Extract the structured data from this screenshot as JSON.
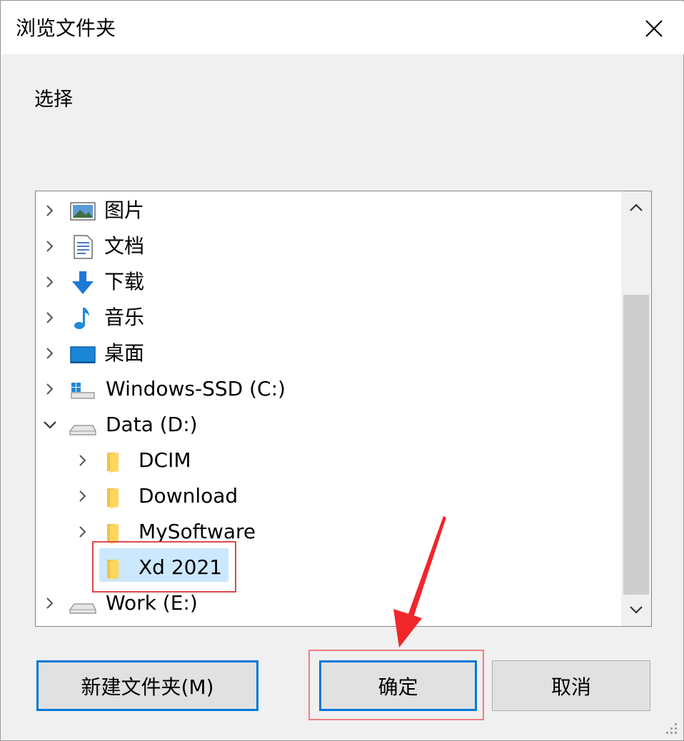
{
  "dialog": {
    "title": "浏览文件夹",
    "prompt": "选择"
  },
  "tree": {
    "items": [
      {
        "label": "图片",
        "icon": "pictures-icon",
        "expanded": false
      },
      {
        "label": "文档",
        "icon": "documents-icon",
        "expanded": false
      },
      {
        "label": "下载",
        "icon": "downloads-icon",
        "expanded": false
      },
      {
        "label": "音乐",
        "icon": "music-icon",
        "expanded": false
      },
      {
        "label": "桌面",
        "icon": "desktop-icon",
        "expanded": false
      },
      {
        "label": "Windows-SSD (C:)",
        "icon": "windows-drive-icon",
        "expanded": false
      },
      {
        "label": "Data (D:)",
        "icon": "drive-icon",
        "expanded": true
      },
      {
        "label": "DCIM",
        "icon": "folder-icon",
        "expanded": false
      },
      {
        "label": "Download",
        "icon": "folder-icon",
        "expanded": false
      },
      {
        "label": "MySoftware",
        "icon": "folder-icon",
        "expanded": false
      },
      {
        "label": "Xd 2021",
        "icon": "folder-icon",
        "selected": true
      },
      {
        "label": "Work (E:)",
        "icon": "drive-icon",
        "expanded": false
      }
    ]
  },
  "buttons": {
    "new_folder": "新建文件夹(M)",
    "ok": "确定",
    "cancel": "取消"
  },
  "colors": {
    "selection": "#cce8ff",
    "focus_border": "#0078d7",
    "annotation_red": "#e0474c",
    "dialog_bg": "#f0f0f0"
  }
}
